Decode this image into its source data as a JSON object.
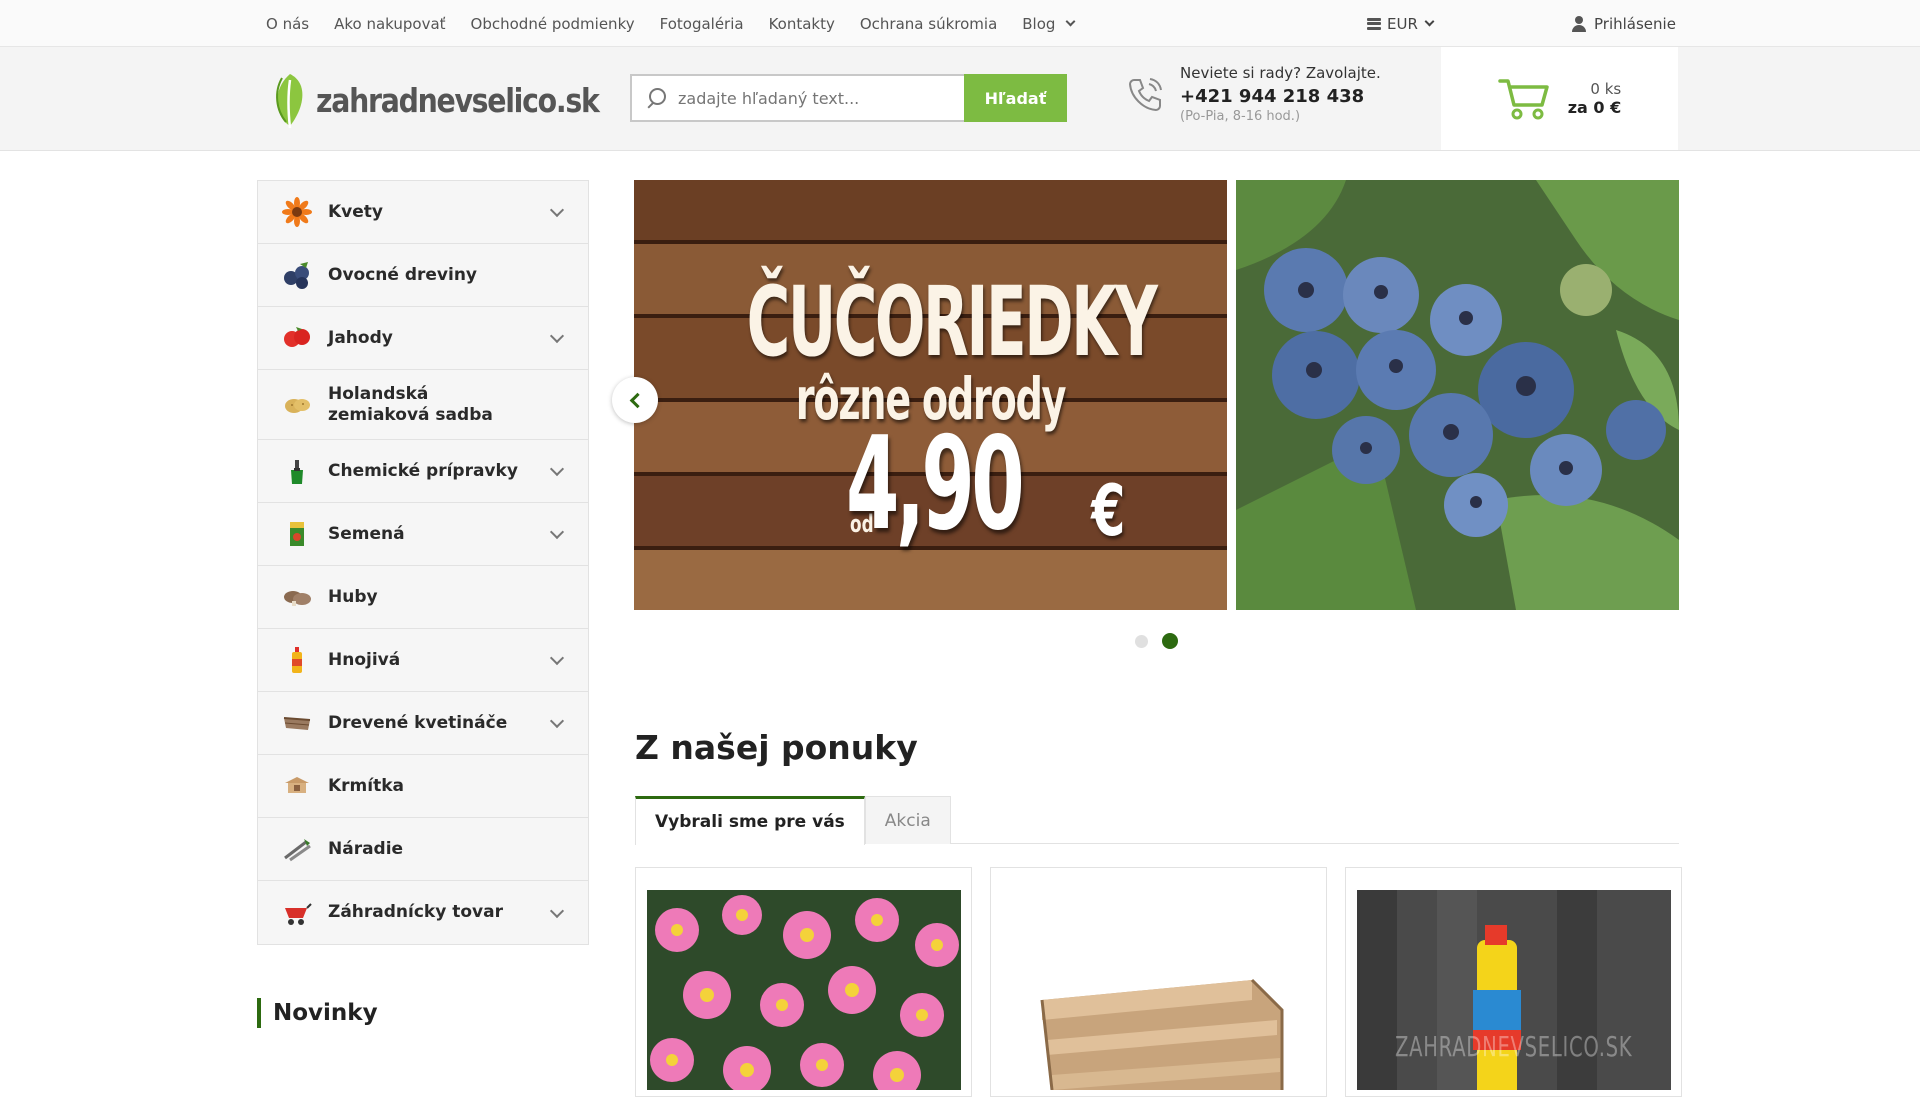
{
  "topnav": {
    "links": [
      "O nás",
      "Ako nakupovať",
      "Obchodné podmienky",
      "Fotogaléria",
      "Kontakty",
      "Ochrana súkromia",
      "Blog"
    ],
    "currency": "EUR",
    "login": "Prihlásenie"
  },
  "header": {
    "logo_text": "zahradnevselico.sk",
    "search_placeholder": "zadajte hľadaný text...",
    "search_button": "Hľadať",
    "contact_question": "Neviete si rady? Zavolajte.",
    "phone": "+421 944 218 438",
    "hours": "(Po-Pia, 8-16 hod.)",
    "cart_count": "0 ks",
    "cart_total": "za 0 €"
  },
  "sidebar": {
    "items": [
      {
        "label": "Kvety",
        "icon": "flower-icon",
        "has_submenu": true
      },
      {
        "label": "Ovocné dreviny",
        "icon": "blueberries-icon",
        "has_submenu": false
      },
      {
        "label": "Jahody",
        "icon": "strawberry-icon",
        "has_submenu": true
      },
      {
        "label": "Holandská zemiaková sadba",
        "icon": "potato-icon",
        "has_submenu": false
      },
      {
        "label": "Chemické prípravky",
        "icon": "sprayer-icon",
        "has_submenu": true
      },
      {
        "label": "Semená",
        "icon": "seed-packet-icon",
        "has_submenu": true
      },
      {
        "label": "Huby",
        "icon": "mushroom-icon",
        "has_submenu": false
      },
      {
        "label": "Hnojivá",
        "icon": "fertilizer-bottle-icon",
        "has_submenu": true
      },
      {
        "label": "Drevené kvetináče",
        "icon": "wooden-planter-icon",
        "has_submenu": true
      },
      {
        "label": "Krmítka",
        "icon": "bird-feeder-icon",
        "has_submenu": false
      },
      {
        "label": "Náradie",
        "icon": "garden-tools-icon",
        "has_submenu": false
      },
      {
        "label": "Záhradnícky tovar",
        "icon": "wheelbarrow-icon",
        "has_submenu": true
      }
    ],
    "novinky": "Novinky"
  },
  "slider": {
    "title": "ČUČORIEDKY",
    "subtitle": "rôzne odrody",
    "od": "od",
    "price": "4,90",
    "currency": "€",
    "active_slide": 2,
    "slide_count": 2
  },
  "offer": {
    "title": "Z našej ponuky",
    "tabs": [
      "Vybrali sme pre vás",
      "Akcia"
    ],
    "active_tab": 0,
    "products": [
      {
        "image": "pink-anemone-flowers"
      },
      {
        "image": "wooden-crate"
      },
      {
        "image": "fertilizer-bottle",
        "watermark": "ZAHRADNEVSELICO.SK"
      }
    ]
  },
  "colors": {
    "accent_green": "#7dbb42",
    "dark_green": "#2d6a10"
  }
}
